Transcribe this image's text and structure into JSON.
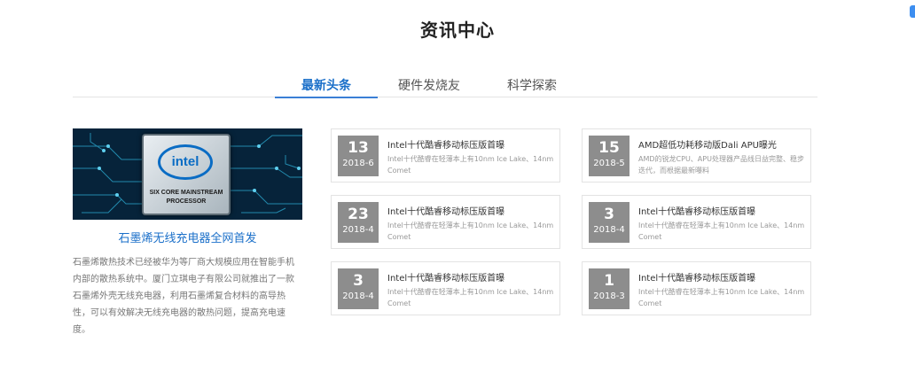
{
  "header": {
    "title": "资讯中心"
  },
  "tabs": [
    {
      "label": "最新头条",
      "active": true
    },
    {
      "label": "硬件发烧友",
      "active": false
    },
    {
      "label": "科学探索",
      "active": false
    }
  ],
  "feature": {
    "image_logo": "intel",
    "image_caption": "SIX CORE MAINSTREAM PROCESSOR",
    "title": "石墨烯无线充电器全网首发",
    "description": "石墨烯散热技术已经被华为等厂商大规模应用在智能手机内部的散热系统中。厦门立琪电子有限公司就推出了一款石墨烯外壳无线充电器，利用石墨烯复合材料的高导热性，可以有效解决无线充电器的散热问题，提高充电速度。"
  },
  "news": [
    {
      "day": "13",
      "ym": "2018-6",
      "title": "Intel十代酷睿移动标压版首曝",
      "excerpt": "Intel十代酷睿在轻薄本上有10nm Ice Lake、14nm Comet"
    },
    {
      "day": "15",
      "ym": "2018-5",
      "title": "AMD超低功耗移动版Dali APU曝光",
      "excerpt": "AMD的锐龙CPU、APU处理器产品线日益完整、稳步迭代，而根据最新曝料"
    },
    {
      "day": "23",
      "ym": "2018-4",
      "title": "Intel十代酷睿移动标压版首曝",
      "excerpt": "Intel十代酷睿在轻薄本上有10nm Ice Lake、14nm Comet"
    },
    {
      "day": "3",
      "ym": "2018-4",
      "title": "Intel十代酷睿移动标压版首曝",
      "excerpt": "Intel十代酷睿在轻薄本上有10nm Ice Lake、14nm Comet"
    },
    {
      "day": "3",
      "ym": "2018-4",
      "title": "Intel十代酷睿移动标压版首曝",
      "excerpt": "Intel十代酷睿在轻薄本上有10nm Ice Lake、14nm Comet"
    },
    {
      "day": "1",
      "ym": "2018-3",
      "title": "Intel十代酷睿移动标压版首曝",
      "excerpt": "Intel十代酷睿在轻薄本上有10nm Ice Lake、14nm Comet"
    }
  ],
  "colors": {
    "accent": "#1a6fc9",
    "date_box": "#8d8d8d"
  }
}
